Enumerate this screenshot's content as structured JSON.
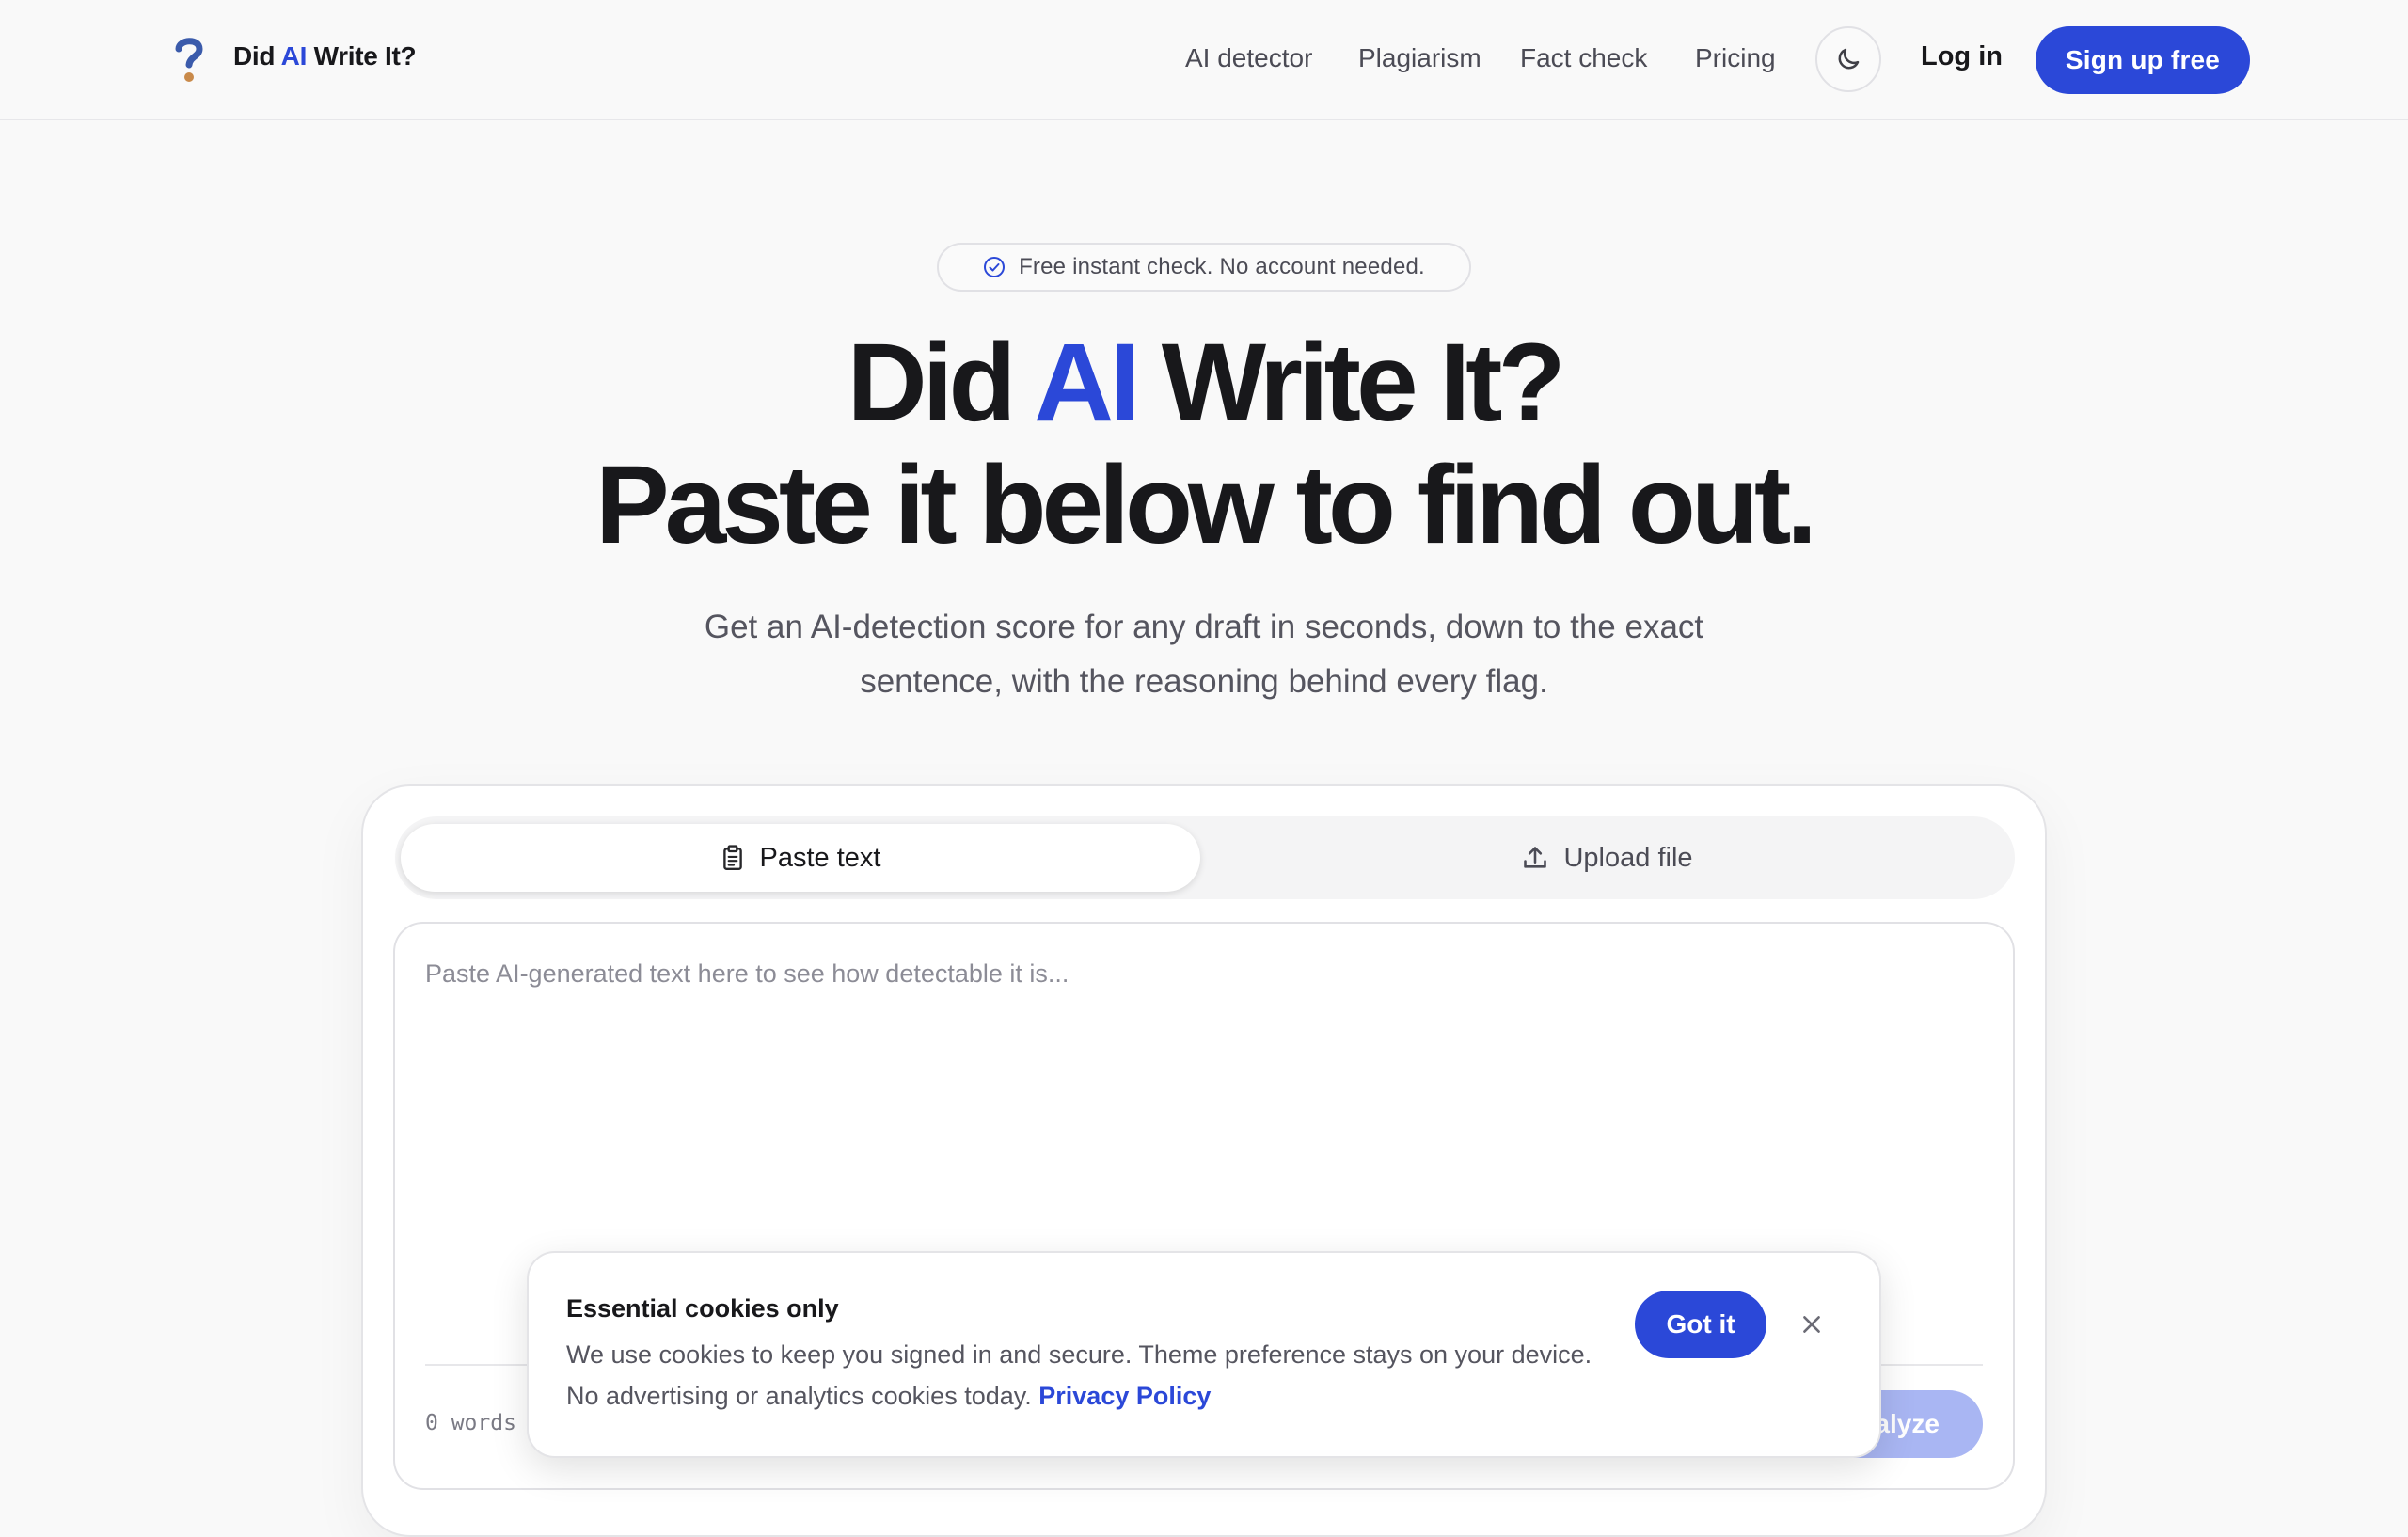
{
  "header": {
    "brand": {
      "prefix": "Did",
      "accent": "AI",
      "suffix": "Write It?"
    },
    "nav": [
      "AI detector",
      "Plagiarism",
      "Fact check",
      "Pricing"
    ],
    "login_label": "Log in",
    "signup_label": "Sign up free",
    "theme_icon": "moon-icon"
  },
  "hero": {
    "badge": "Free instant check. No account needed.",
    "title_line1": {
      "prefix": "Did",
      "accent": "AI",
      "suffix": "Write It?"
    },
    "title_line2": "Paste it below to find out.",
    "subtitle": "Get an AI-detection score for any draft in seconds, down to the exact sentence, with the reasoning behind every flag."
  },
  "input_card": {
    "tabs": [
      {
        "label": "Paste text",
        "icon": "clipboard-icon",
        "active": true
      },
      {
        "label": "Upload file",
        "icon": "upload-icon",
        "active": false
      }
    ],
    "placeholder": "Paste AI-generated text here to see how detectable it is...",
    "word_count": "0 words",
    "analyze_label": "Analyze"
  },
  "cookie_banner": {
    "title": "Essential cookies only",
    "text": "We use cookies to keep you signed in and secure. Theme preference stays on your device. No advertising or analytics cookies today.",
    "link_label": "Privacy Policy",
    "accept_label": "Got it"
  },
  "colors": {
    "accent": "#2b48d8",
    "background": "#f9f9f9",
    "text": "#18181b",
    "muted": "#55555f"
  }
}
